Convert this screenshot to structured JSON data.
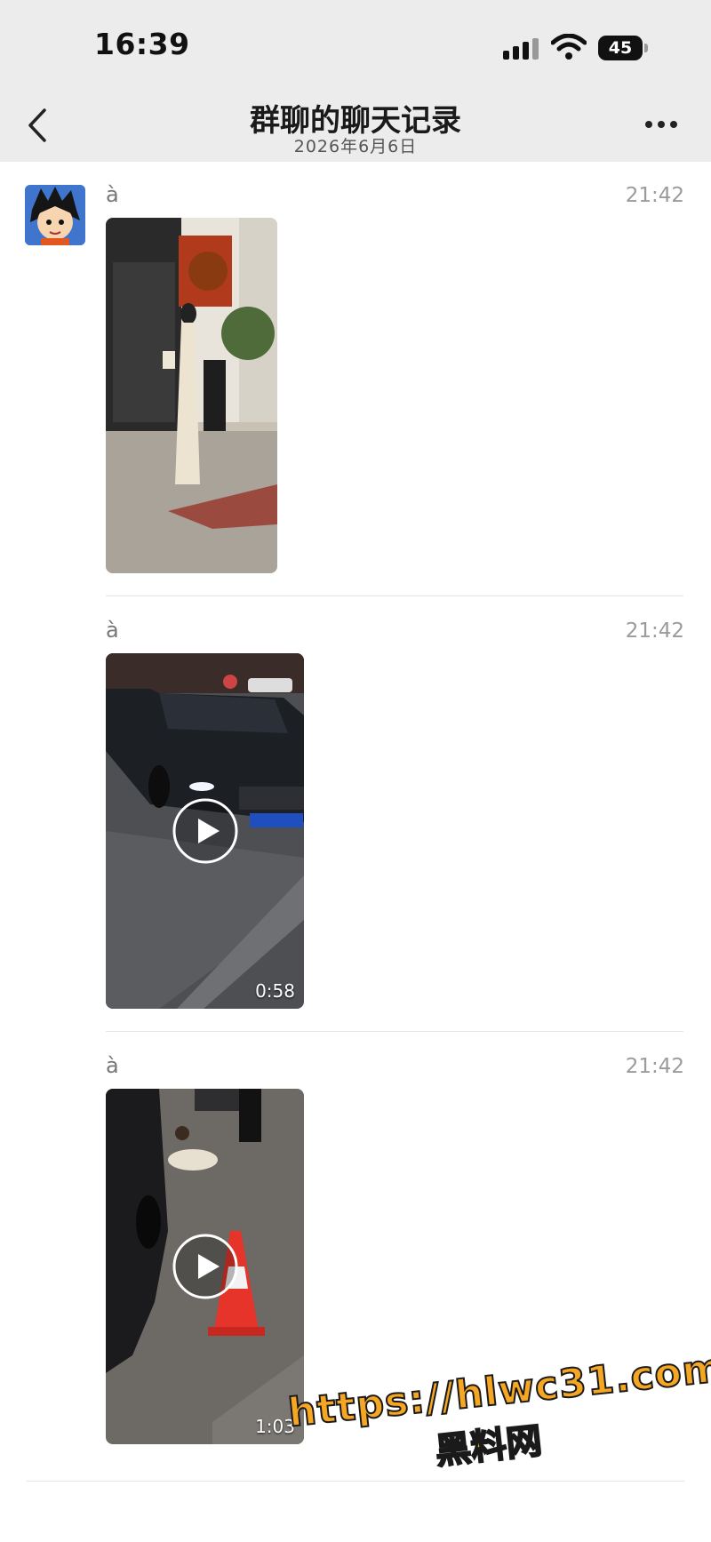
{
  "status_bar": {
    "time": "16:39",
    "battery": "45"
  },
  "nav": {
    "title": "群聊的聊天记录",
    "date": "2026年6月6日"
  },
  "messages": [
    {
      "sender": "à",
      "time": "21:42",
      "type": "image"
    },
    {
      "sender": "à",
      "time": "21:42",
      "type": "video",
      "duration": "0:58"
    },
    {
      "sender": "à",
      "time": "21:42",
      "type": "video",
      "duration": "1:03"
    }
  ],
  "watermark": {
    "line1": "https://hlwc31.com",
    "line2": "黑料网"
  },
  "colors": {
    "nav_bg": "#ececec",
    "text_secondary": "#9b9b9b",
    "watermark": "#f5a623"
  }
}
